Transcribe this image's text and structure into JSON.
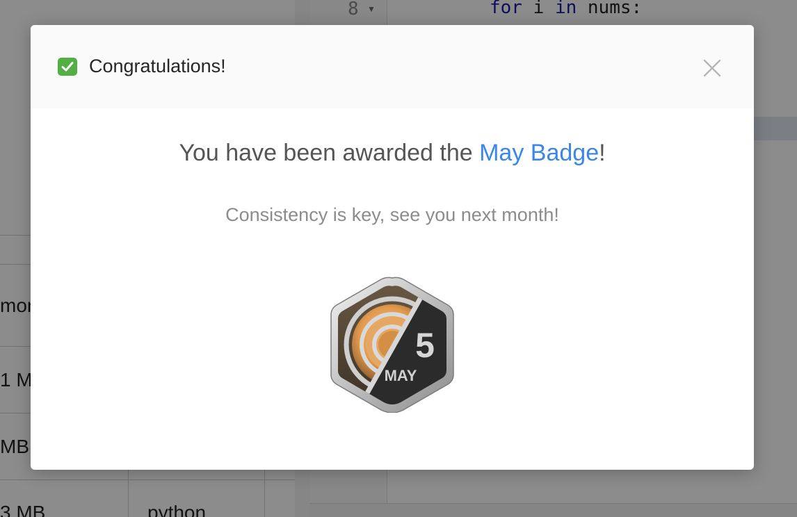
{
  "background": {
    "editor": {
      "line_number": "8",
      "code_keyword_for": "for",
      "code_var": " i ",
      "code_keyword_in": "in",
      "code_rest": " nums:"
    },
    "left_panel": {
      "row_texts": [
        "mor",
        "1 M",
        "MB",
        "3 MB"
      ],
      "cell_text": "python"
    }
  },
  "modal": {
    "title": "Congratulations!",
    "award_prefix": "You have been awarded the ",
    "badge_name": "May Badge",
    "award_suffix": "!",
    "subtitle": "Consistency is key, see you next month!",
    "badge": {
      "number": "5",
      "month": "MAY"
    },
    "icons": {
      "title": "check-mark-icon",
      "close": "close-icon"
    }
  },
  "colors": {
    "link": "#3b87e8",
    "check": "#52b043",
    "badge_orange": "#e8a35a",
    "badge_dark": "#2b2b2b"
  }
}
